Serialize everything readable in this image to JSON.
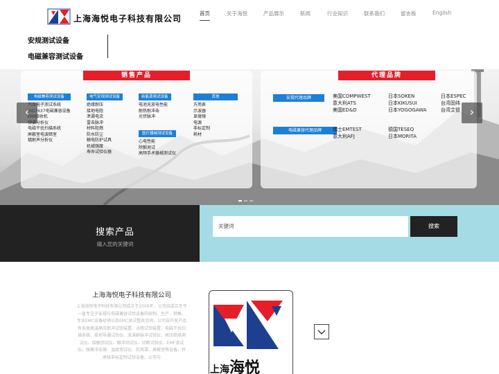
{
  "header": {
    "company_name": "上海海悦电子科技有限公司",
    "nav": [
      {
        "label": "首页",
        "active": true
      },
      {
        "label": "关于海悦",
        "active": false
      },
      {
        "label": "产品展示",
        "active": false
      },
      {
        "label": "新闻",
        "active": false
      },
      {
        "label": "行业知识",
        "active": false
      },
      {
        "label": "联系我们",
        "active": false
      },
      {
        "label": "留言板",
        "active": false
      },
      {
        "label": "English",
        "active": false
      }
    ],
    "tagline": [
      "安规测试设备",
      "电磁兼容测试设备"
    ]
  },
  "banner": {
    "sales_title": "销售产品",
    "agency_title": "代理品牌",
    "categories": [
      {
        "title": "电磁兼容测试设备",
        "items": [
          "汽车电子测试系统",
          "ISO7637电磁兼容设备",
          "EMI接收机",
          "频谱分析仪",
          "电磁干扰扫描系统",
          "屏蔽室电波暗室",
          "辐射声分析仪"
        ]
      },
      {
        "title": "电气安规测试设备",
        "items": [
          "绝缘耐压",
          "接地电阻",
          "泄漏电流",
          "雷击脉冲",
          "材料阻燃",
          "防水防尘",
          "触电防护试具",
          "机械强度",
          "寿命试验仪器"
        ]
      },
      {
        "title": "新能源测试设备",
        "items": [
          "电池充放电性能",
          "耐热耐冲击",
          "光伏脉冲"
        ]
      },
      {
        "title": "医疗器械测试设备",
        "items": [
          "心电性能",
          "除颤测试",
          "高频手术器械测试仪"
        ]
      },
      {
        "title": "其他",
        "items": [
          "万用表",
          "示波器",
          "显微镜",
          "电源",
          "非标定制",
          "耗材"
        ]
      }
    ],
    "safety_brands_label": "安规代理品牌",
    "emc_brands_label": "电磁兼容代理品牌",
    "safety_brands": [
      [
        "美国COMPWEST",
        "意大利ATS",
        "美国ED&D"
      ],
      [
        "日本SOKEN",
        "日本KIKUSUI",
        "日本YOGOGAWA"
      ],
      [
        "日本ESPEC",
        "台湾固纬",
        "台湾艾德"
      ]
    ],
    "emc_brands": [
      [
        "瑞士EMTEST",
        "意大利AFJ"
      ],
      [
        "德国TESEQ",
        "日本MORITA"
      ]
    ],
    "prev_icon": "chevron-left-icon",
    "next_icon": "chevron-right-icon"
  },
  "search": {
    "title": "搜索产品",
    "subtitle": "输入您的关键词",
    "placeholder": "关键词",
    "button_label": "搜索"
  },
  "about": {
    "title": "上海海悦电子科技有限公司",
    "body": "上海海悦电子科技有限公司成立于2006年，公司自成立至今一直专注于安规与电磁兼容试验设备的研制、生产、销售。专业EMC设备经销以及EMC测试整改咨询。公司自开发产品有各类高温高压耐冲试验装置、冰雨试验装置、电磁干扰扫描系统、接地导通试验仪、浪涌群脉冲试验仪、高压绝缘测试仪、接触测试仪、触冲测试仪、切断试验仪、EMF测试仪、弹簧冲击锤、温度测试仪、防风罩、屏蔽室等设备，并承接非标定制试验设备。公司与",
    "card_name_small": "上海",
    "card_name_big": "海悦",
    "down_icon": "chevron-down-icon"
  }
}
